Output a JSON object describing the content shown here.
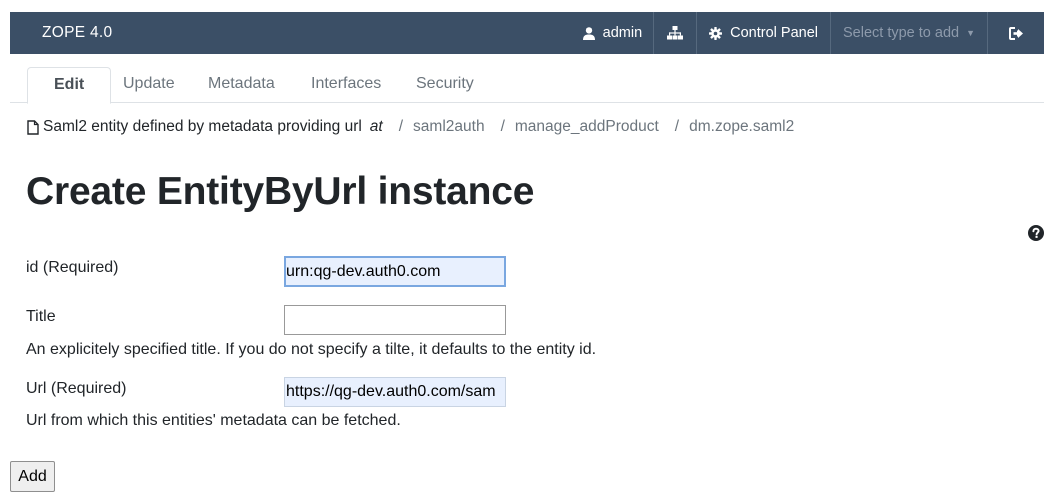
{
  "topbar": {
    "brand": "ZOPE 4.0",
    "user": "admin",
    "control_panel": "Control Panel",
    "select_placeholder": "Select type to add",
    "colors": {
      "bar": "#3b4f66",
      "text": "#ffffff",
      "muted": "#8d9aab"
    },
    "icons": [
      "user-icon",
      "sitemap-icon",
      "gear-icon",
      "caret-down-icon",
      "logout-icon"
    ]
  },
  "tabs": [
    {
      "label": "Edit",
      "active": true
    },
    {
      "label": "Update",
      "active": false
    },
    {
      "label": "Metadata",
      "active": false
    },
    {
      "label": "Interfaces",
      "active": false
    },
    {
      "label": "Security",
      "active": false
    }
  ],
  "breadcrumb": {
    "title": "Saml2 entity defined by metadata providing url",
    "at": "at",
    "separator": "/",
    "items": [
      "saml2auth",
      "manage_addProduct",
      "dm.zope.saml2"
    ]
  },
  "page_title": "Create EntityByUrl instance",
  "form": {
    "id": {
      "label": "id (Required)",
      "value": "urn:qg-dev.auth0.com"
    },
    "title": {
      "label": "Title",
      "value": "",
      "hint": "An explicitely specified title. If you do not specify a tilte, it defaults to the entity id."
    },
    "url": {
      "label": "Url (Required)",
      "value": "https://qg-dev.auth0.com/sam",
      "hint": "Url from which this entities' metadata can be fetched."
    },
    "submit_label": "Add"
  }
}
